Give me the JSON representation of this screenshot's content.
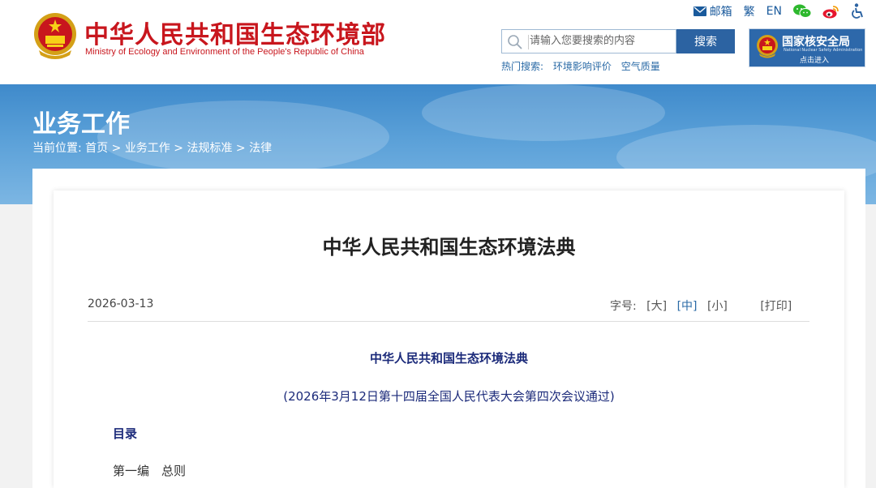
{
  "site": {
    "name_cn": "中华人民共和国生态环境部",
    "name_en": "Ministry of Ecology and Environment of the People's Republic of China"
  },
  "toplinks": {
    "mail": "邮箱",
    "traditional": "繁",
    "english": "EN"
  },
  "search": {
    "placeholder": "请输入您要搜索的内容",
    "button": "搜索",
    "hot_label": "热门搜索:",
    "hot_items": [
      "环境影响评价",
      "空气质量"
    ]
  },
  "nnsa": {
    "name_cn": "国家核安全局",
    "name_en": "National Nuclear Safety Administration",
    "enter": "点击进入"
  },
  "banner": {
    "title": "业务工作",
    "crumb_prefix": "当前位置:",
    "crumbs": [
      "首页",
      "业务工作",
      "法规标准",
      "法律"
    ],
    "separator": ">"
  },
  "article": {
    "title": "中华人民共和国生态环境法典",
    "date": "2026-03-13",
    "font_label": "字号:",
    "font_large": "[大]",
    "font_medium": "[中]",
    "font_small": "[小]",
    "print": "[打印]",
    "law_name": "中华人民共和国生态环境法典",
    "law_passed": "(2026年3月12日第十四届全国人民代表大会第四次会议通过)",
    "toc": "目录",
    "part1": "第一编　总则"
  },
  "colors": {
    "brand_red": "#c8161d",
    "brand_blue": "#2c63a2",
    "text_navy": "#1b2a7a"
  }
}
